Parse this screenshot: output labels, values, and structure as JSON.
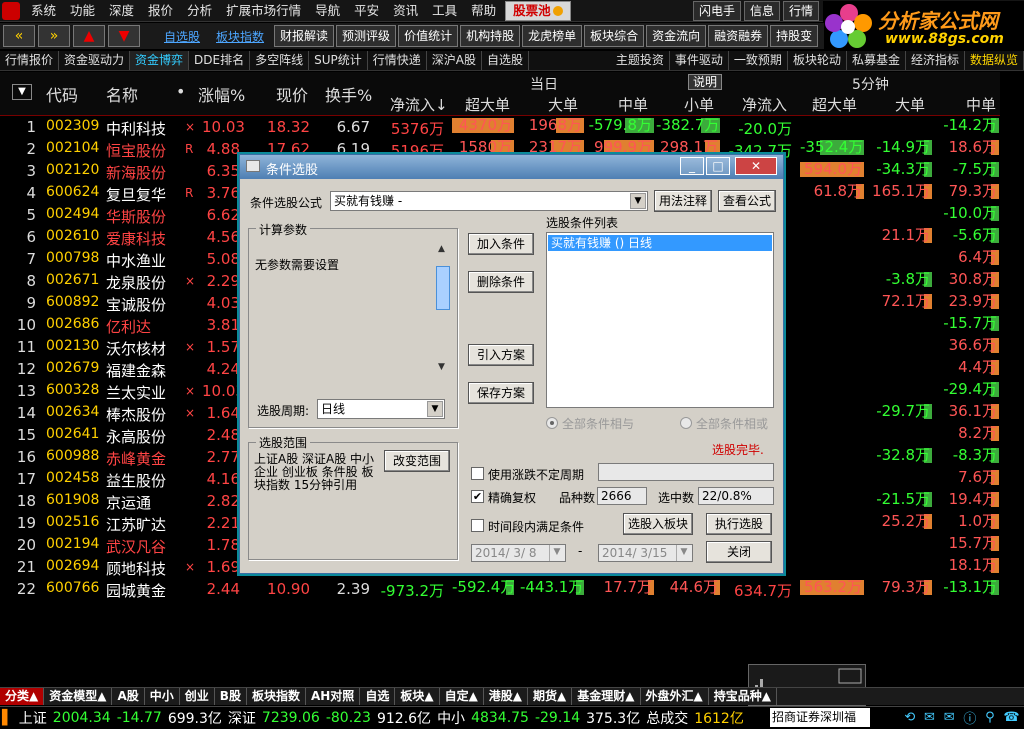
{
  "menu": {
    "items": [
      "系统",
      "功能",
      "深度",
      "报价",
      "分析",
      "扩展市场行情",
      "导航",
      "平安",
      "资讯",
      "工具",
      "帮助"
    ],
    "hot": "股票池",
    "right": [
      "闪电手",
      "信息",
      "行情"
    ]
  },
  "logo": {
    "title": "分析家公式网",
    "url": "www.88gs.com"
  },
  "toolbar": {
    "nav": [
      "«",
      "»",
      "▲",
      "▼"
    ],
    "links": [
      "自选股",
      "板块指数"
    ],
    "buttons": [
      "财报解读",
      "预测评级",
      "价值统计",
      "机构持股",
      "龙虎榜单",
      "板块综合",
      "资金流向",
      "融资融券",
      "持股变"
    ]
  },
  "subtabs": {
    "items": [
      "行情报价",
      "资金驱动力",
      "资金博弈",
      "DDE排名",
      "多空阵线",
      "SUP统计",
      "行情快递",
      "深沪A股",
      "自选股"
    ],
    "active_index": 2,
    "right_items": [
      "主题投资",
      "事件驱动",
      "一致预期",
      "板块轮动",
      "私募基金",
      "经济指标",
      "数据纵览"
    ]
  },
  "header": {
    "today": "当日",
    "explain": "说明",
    "min5": "5分钟",
    "cols": {
      "code": "代码",
      "name": "名称",
      "dot": "•",
      "chg": "涨幅%",
      "price": "现价",
      "turn": "换手%",
      "net": "净流入↓",
      "xl": "超大单",
      "l": "大单",
      "m": "中单",
      "s": "小单",
      "net5": "净流入",
      "xl5": "超大单",
      "l5": "大单",
      "m5": "中单"
    }
  },
  "rows": [
    {
      "no": "1",
      "code": "002309",
      "name": "中利科技",
      "tag": "×",
      "chg": "10.03",
      "price": "18.32",
      "turn": "6.67",
      "net": "5376万",
      "xl": "4370万",
      "l": "1968万",
      "m": "-579.8万",
      "s": "-382.7万",
      "net5": "-20.0万",
      "l5": "",
      "m5": "-14.2万",
      "red": false
    },
    {
      "no": "2",
      "code": "002104",
      "name": "恒宝股份",
      "tag": "R",
      "chg": "4.88",
      "price": "17.62",
      "turn": "6.19",
      "net": "5196万",
      "xl": "1580万",
      "l": "2317万",
      "m": "999.9万",
      "s": "298.1万",
      "net5": "-342.7万",
      "xl5": "-352.4万",
      "l5": "-14.9万",
      "m5": "18.6万",
      "red": true
    },
    {
      "no": "3",
      "code": "002120",
      "name": "新海股份",
      "tag": "",
      "chg": "6.35",
      "price": "",
      "turn": "",
      "net": "",
      "xl5": "594.0万",
      "l5": "-34.3万",
      "m5": "-7.5万",
      "red": true
    },
    {
      "no": "4",
      "code": "600624",
      "name": "复旦复华",
      "tag": "R",
      "chg": "3.76",
      "price": "",
      "turn": "",
      "net": "",
      "xl5": "61.8万",
      "l5": "165.1万",
      "m5": "79.3万",
      "red": false
    },
    {
      "no": "5",
      "code": "002494",
      "name": "华斯股份",
      "tag": "",
      "chg": "6.62",
      "m5": "-10.0万",
      "red": true
    },
    {
      "no": "6",
      "code": "002610",
      "name": "爱康科技",
      "tag": "",
      "chg": "4.56",
      "l5": "21.1万",
      "m5": "-5.6万",
      "red": true
    },
    {
      "no": "7",
      "code": "000798",
      "name": "中水渔业",
      "tag": "",
      "chg": "5.08",
      "m5": "6.4万",
      "red": false
    },
    {
      "no": "8",
      "code": "002671",
      "name": "龙泉股份",
      "tag": "×",
      "chg": "2.29",
      "l5": "-3.8万",
      "m5": "30.8万",
      "red": false
    },
    {
      "no": "9",
      "code": "600892",
      "name": "宝诚股份",
      "tag": "",
      "chg": "4.03",
      "l5": "72.1万",
      "m5": "23.9万",
      "red": false
    },
    {
      "no": "10",
      "code": "002686",
      "name": "亿利达",
      "tag": "",
      "chg": "3.81",
      "m5": "-15.7万",
      "red": true
    },
    {
      "no": "11",
      "code": "002130",
      "name": "沃尔核材",
      "tag": "×",
      "chg": "1.57",
      "m5": "36.6万",
      "red": false
    },
    {
      "no": "12",
      "code": "002679",
      "name": "福建金森",
      "tag": "",
      "chg": "4.24",
      "m5": "4.4万",
      "red": false
    },
    {
      "no": "13",
      "code": "600328",
      "name": "兰太实业",
      "tag": "×",
      "chg": "10.03",
      "m5": "-29.4万",
      "red": false
    },
    {
      "no": "14",
      "code": "002634",
      "name": "棒杰股份",
      "tag": "×",
      "chg": "1.64",
      "l5": "-29.7万",
      "m5": "36.1万",
      "red": false
    },
    {
      "no": "15",
      "code": "002641",
      "name": "永高股份",
      "tag": "",
      "chg": "2.48",
      "m5": "8.2万",
      "red": false
    },
    {
      "no": "16",
      "code": "600988",
      "name": "赤峰黄金",
      "tag": "",
      "chg": "2.77",
      "l5": "-32.8万",
      "m5": "-8.3万",
      "red": true
    },
    {
      "no": "17",
      "code": "002458",
      "name": "益生股份",
      "tag": "",
      "chg": "4.16",
      "m5": "7.6万",
      "red": false
    },
    {
      "no": "18",
      "code": "601908",
      "name": "京运通",
      "tag": "",
      "chg": "2.82",
      "l5": "-21.5万",
      "m5": "19.4万",
      "red": false
    },
    {
      "no": "19",
      "code": "002516",
      "name": "江苏旷达",
      "tag": "",
      "chg": "2.21",
      "l5": "25.2万",
      "m5": "1.0万",
      "red": false
    },
    {
      "no": "20",
      "code": "002194",
      "name": "武汉凡谷",
      "tag": "",
      "chg": "1.78",
      "m5": "15.7万",
      "red": true
    },
    {
      "no": "21",
      "code": "002694",
      "name": "顾地科技",
      "tag": "×",
      "chg": "1.69",
      "m5": "18.1万",
      "red": false
    },
    {
      "no": "22",
      "code": "600766",
      "name": "园城黄金",
      "tag": "",
      "chg": "2.44",
      "price": "10.90",
      "turn": "2.39",
      "net": "-973.2万",
      "xl": "-592.4万",
      "l": "-443.1万",
      "m": "17.7万",
      "s": "44.6万",
      "net5": "634.7万",
      "xl5": "563.2万",
      "l5": "79.3万",
      "m5": "-13.1万",
      "red": false
    }
  ],
  "dialog": {
    "title": "条件选股",
    "formula_label": "条件选股公式",
    "formula_value": "买就有钱赚 -",
    "btn_comment": "用法注释",
    "btn_view": "查看公式",
    "params_title": "计算参数",
    "params_text": "无参数需要设置",
    "list_title": "选股条件列表",
    "list_item": "买就有钱赚 () 日线",
    "btn_add": "加入条件",
    "btn_del": "删除条件",
    "btn_import": "引入方案",
    "btn_save": "保存方案",
    "period_label": "选股周期:",
    "period_value": "日线",
    "all_and": "全部条件相与",
    "all_or": "全部条件相或",
    "done": "选股完毕.",
    "range_title": "选股范围",
    "range_text": "上证A股 深证A股 中小企业 创业板 条件股 板块指数 15分钟引用",
    "btn_change": "改变范围",
    "opt_uncertain": "使用涨跌不定周期",
    "opt_exact": "精确复权",
    "count_label": "品种数",
    "count_value": "2666",
    "hit_label": "选中数",
    "hit_value": "22/0.8%",
    "opt_period": "时间段内满足条件",
    "btn_toblock": "选股入板块",
    "btn_run": "执行选股",
    "date_from": "2014/ 3/ 8",
    "date_to": "2014/ 3/15",
    "dash": "-",
    "btn_close": "关闭"
  },
  "bottom_tabs": [
    "分类▲",
    "资金模型▲",
    "A股",
    "中小",
    "创业",
    "B股",
    "板块指数",
    "AH对照",
    "自选",
    "板块▲",
    "自定▲",
    "港股▲",
    "期货▲",
    "基金理财▲",
    "外盘外汇▲",
    "持宝品种▲"
  ],
  "status": {
    "sh_label": "上证",
    "sh_val": "2004.34",
    "sh_chg": "-14.77",
    "sh_amt": "699.3亿",
    "sz_label": "深证",
    "sz_val": "7239.06",
    "sz_chg": "-80.23",
    "sz_amt": "912.6亿",
    "zx_label": "中小",
    "zx_val": "4834.75",
    "zx_chg": "-29.14",
    "zx_amt": "375.3亿",
    "total_label": "总成交",
    "total_val": "1612亿",
    "ticker": "招商证券深圳福"
  },
  "colors": {
    "accent": "#ffd000",
    "up": "#ff4444",
    "down": "#33ff33",
    "bar_up": "#e08030",
    "bar_down": "#3cab3c"
  }
}
